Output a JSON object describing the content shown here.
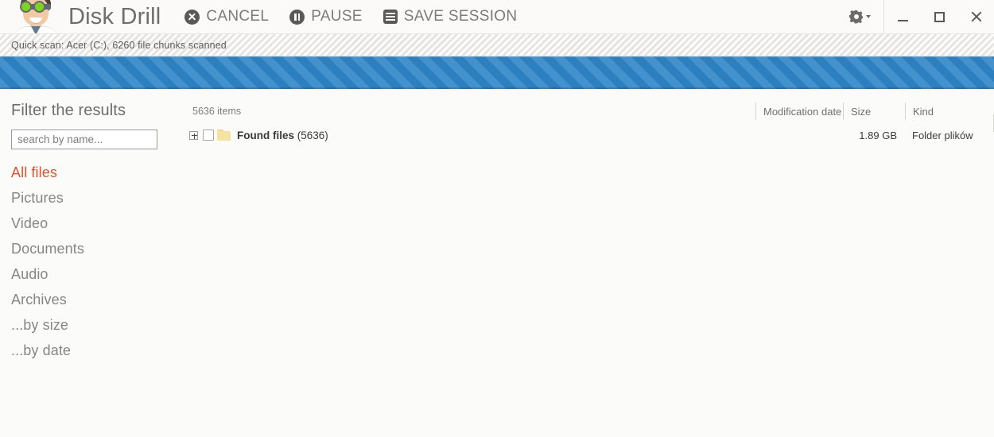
{
  "app": {
    "brand": "Disk Drill"
  },
  "toolbar": {
    "cancel_label": "CANCEL",
    "pause_label": "PAUSE",
    "save_session_label": "SAVE SESSION",
    "cancel_icon": "cancel-circle-icon",
    "pause_icon": "pause-circle-icon",
    "save_icon": "save-session-icon",
    "gear_icon": "gear-icon",
    "gear_caret_icon": "chevron-down-icon"
  },
  "window_controls": {
    "minimize": "minimize-icon",
    "maximize": "maximize-icon",
    "close": "close-icon"
  },
  "scan": {
    "status_text": "Quick scan: Acer (C:), 6260 file chunks scanned",
    "progress_color": "#2e86c8"
  },
  "sidebar": {
    "title": "Filter the results",
    "search_placeholder": "search by name...",
    "search_value": "",
    "active_color": "#e1522a",
    "items": [
      {
        "label": "All files",
        "active": true
      },
      {
        "label": "Pictures",
        "active": false
      },
      {
        "label": "Video",
        "active": false
      },
      {
        "label": "Documents",
        "active": false
      },
      {
        "label": "Audio",
        "active": false
      },
      {
        "label": "Archives",
        "active": false
      },
      {
        "label": "...by size",
        "active": false
      },
      {
        "label": "...by date",
        "active": false
      }
    ]
  },
  "files": {
    "item_count_label": "5636 items",
    "columns": {
      "modification_date": "Modification date",
      "size": "Size",
      "kind": "Kind"
    },
    "rows": [
      {
        "name": "Found files",
        "count_label": "(5636)",
        "modification_date": "",
        "size": "1.89 GB",
        "kind": "Folder plików",
        "checked": false,
        "expanded": false,
        "icon": "folder-icon"
      }
    ]
  }
}
